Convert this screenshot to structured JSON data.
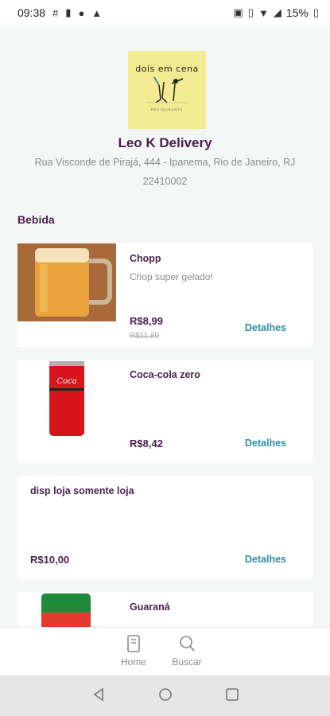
{
  "status_bar": {
    "time": "09:38",
    "battery": "15%"
  },
  "store": {
    "logo_text": "dois em cena",
    "logo_subtext": "RESTAURANTE",
    "name": "Leo K Delivery",
    "address_line1": "Rua Visconde de Pirajá, 444 - Ipanema, Rio de Janeiro, RJ",
    "address_line2": "22410002"
  },
  "section": {
    "title": "Bebida"
  },
  "products": [
    {
      "name": "Chopp",
      "description": "Chop super gelado!",
      "price": "R$8,99",
      "old_price": "R$11,89",
      "details_label": "Detalhes"
    },
    {
      "name": "Coca-cola zero",
      "price": "R$8,42",
      "details_label": "Detalhes"
    },
    {
      "name": "disp loja somente loja",
      "price": "R$10,00",
      "details_label": "Detalhes"
    },
    {
      "name": "Guaraná"
    }
  ],
  "bottom_nav": {
    "home_label": "Home",
    "search_label": "Buscar"
  },
  "colors": {
    "brand": "#4a1f4c",
    "link": "#2e8fa8",
    "logo_bg": "#f4ea92"
  }
}
